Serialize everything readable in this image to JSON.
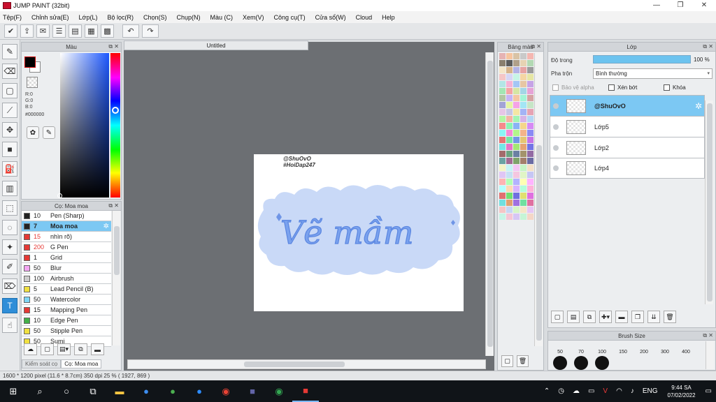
{
  "window": {
    "title": "JUMP PAINT (32bit)",
    "controls": [
      "—",
      "❐",
      "✕"
    ]
  },
  "menu": [
    "Tệp(F)",
    "Chỉnh sửa(E)",
    "Lớp(L)",
    "Bộ lọc(R)",
    "Chọn(S)",
    "Chụp(N)",
    "Màu (C)",
    "Xem(V)",
    "Công cụ(T)",
    "Cửa sổ(W)",
    "Cloud",
    "Help"
  ],
  "color_panel": {
    "title": "Màu",
    "r": "R:0",
    "g": "G:0",
    "b": "B:0",
    "hex": "#000000",
    "fg_color": "#000000",
    "bg_color": "#ffffff"
  },
  "brush_panel": {
    "title": "Cọ: Moa moa",
    "items": [
      {
        "size": "10",
        "name": "Pen (Sharp)",
        "color": "#222222"
      },
      {
        "size": "7",
        "name": "Moa moa",
        "color": "#222222",
        "selected": true
      },
      {
        "size": "15",
        "name": "nhìn rõ)",
        "color": "#e53935",
        "red_size": true
      },
      {
        "size": "200",
        "name": "G Pen",
        "color": "#e53935",
        "red_size": true
      },
      {
        "size": "1",
        "name": "Grid",
        "color": "#e53935"
      },
      {
        "size": "50",
        "name": "Blur",
        "color": "#f4a6f4"
      },
      {
        "size": "100",
        "name": "Airbrush",
        "color": "#cccccc"
      },
      {
        "size": "5",
        "name": "Lead Pencil (B)",
        "color": "#f0e040"
      },
      {
        "size": "50",
        "name": "Watercolor",
        "color": "#7fd6f5"
      },
      {
        "size": "15",
        "name": "Mapping Pen",
        "color": "#e53935"
      },
      {
        "size": "10",
        "name": "Edge Pen",
        "color": "#43b049"
      },
      {
        "size": "50",
        "name": "Stipple Pen",
        "color": "#f0e040"
      },
      {
        "size": "50",
        "name": "Sumi",
        "color": "#f0e040"
      }
    ],
    "tabs": [
      "Kiểm soát cọ",
      "Cọ: Moa moa"
    ]
  },
  "canvas": {
    "tab_title": "Untitled",
    "watermark_line1": "@ShuOvO",
    "watermark_line2": "#HoiDap247",
    "art_text": "Vẽ mầm"
  },
  "palette_panel": {
    "title": "Bảng màu",
    "colors": [
      "#e6b3b3",
      "#f7c59f",
      "#d9c3a5",
      "#c9c9c9",
      "#f5b7b1",
      "#8a7f6e",
      "#5c5c5c",
      "#b0a08a",
      "#e6d3b3",
      "#b3d9b3",
      "#f5e6c8",
      "#d6b38a",
      "#b3b3e6",
      "#e6a3a3",
      "#9a9a9a",
      "#f5c6c6",
      "#d6d6f5",
      "#c6f5e6",
      "#f5d6a3",
      "#e6e6a3",
      "#b3e6e6",
      "#f5b3d6",
      "#a3c6f5",
      "#e6c6a3",
      "#c6a3e6",
      "#a3e6b3",
      "#f5a3a3",
      "#d6e6a3",
      "#a3d6e6",
      "#e6a3d6",
      "#b3c6a3",
      "#c6b3f5",
      "#f5c6a3",
      "#a3f5d6",
      "#d6a3a3",
      "#a3a3d6",
      "#e6f5a3",
      "#f5a3e6",
      "#a3e6f5",
      "#c6e6c6",
      "#e6c6e6",
      "#c6c6e6",
      "#f5e6a3",
      "#a3b3f5",
      "#e6a3b3",
      "#b3f5a3",
      "#f5b3a3",
      "#a3f5b3",
      "#d6b3e6",
      "#b3d6f5",
      "#f58a8a",
      "#8af5b3",
      "#8ab3f5",
      "#f5d68a",
      "#d68af5",
      "#8af5f5",
      "#f58ad6",
      "#b3f58a",
      "#f5b38a",
      "#8a8af5",
      "#e67373",
      "#73e6a3",
      "#7396e6",
      "#e6c673",
      "#c673e6",
      "#73e6e6",
      "#e673c6",
      "#a3e673",
      "#e6a373",
      "#7373e6",
      "#a36b6b",
      "#6ba37f",
      "#6b7fa3",
      "#a3936b",
      "#936ba3",
      "#6ba3a3",
      "#a36b93",
      "#7fa36b",
      "#a37f6b",
      "#6b6ba3",
      "#f5f5c6",
      "#c6f5f5",
      "#f5c6f5",
      "#c6f5c6",
      "#f5e0c6",
      "#e0c6f5",
      "#c6e0f5",
      "#f5c6e0",
      "#e0f5c6",
      "#c6c6f5",
      "#ffb3b3",
      "#b3ffb3",
      "#b3b3ff",
      "#ffffb3",
      "#ffb3ff",
      "#b3ffff",
      "#ffd9b3",
      "#d9b3ff",
      "#b3ffd9",
      "#ffb3d9",
      "#e07070",
      "#70e070",
      "#7070e0",
      "#e0e070",
      "#e070e0",
      "#70e0e0",
      "#e0a070",
      "#a070e0",
      "#70e0a0",
      "#e070a0",
      "#f5c6c6",
      "#c6d6f5",
      "#d6f5c6",
      "#f5e6c6",
      "#e6c6f5",
      "#c6f5e6",
      "#f5c6d6",
      "#d6c6f5",
      "#c6f5d6",
      "#f5d6c6"
    ]
  },
  "layer_panel": {
    "title": "Lớp",
    "opacity_label": "Độ trong",
    "opacity_value": "100 %",
    "opacity": 1.0,
    "blend_label": "Pha trộn",
    "blend_value": "Bình thường",
    "protect_alpha": "Bảo vệ alpha",
    "clipping": "Xén bớt",
    "lock": "Khóa",
    "layers": [
      {
        "name": "@ShuOvO",
        "selected": true
      },
      {
        "name": "Lớp5"
      },
      {
        "name": "Lớp2"
      },
      {
        "name": "Lớp4"
      }
    ]
  },
  "brush_size_panel": {
    "title": "Brush Size",
    "sizes": [
      "50",
      "70",
      "100",
      "150",
      "200",
      "300",
      "400"
    ]
  },
  "status": {
    "text": "1600 * 1200 pixel  (11.6 * 8.7cm)  350 dpi  25 %  ( 1927, 869 )"
  },
  "taskbar": {
    "lang": "ENG",
    "time": "9:44 SA",
    "date": "07/02/2022"
  }
}
